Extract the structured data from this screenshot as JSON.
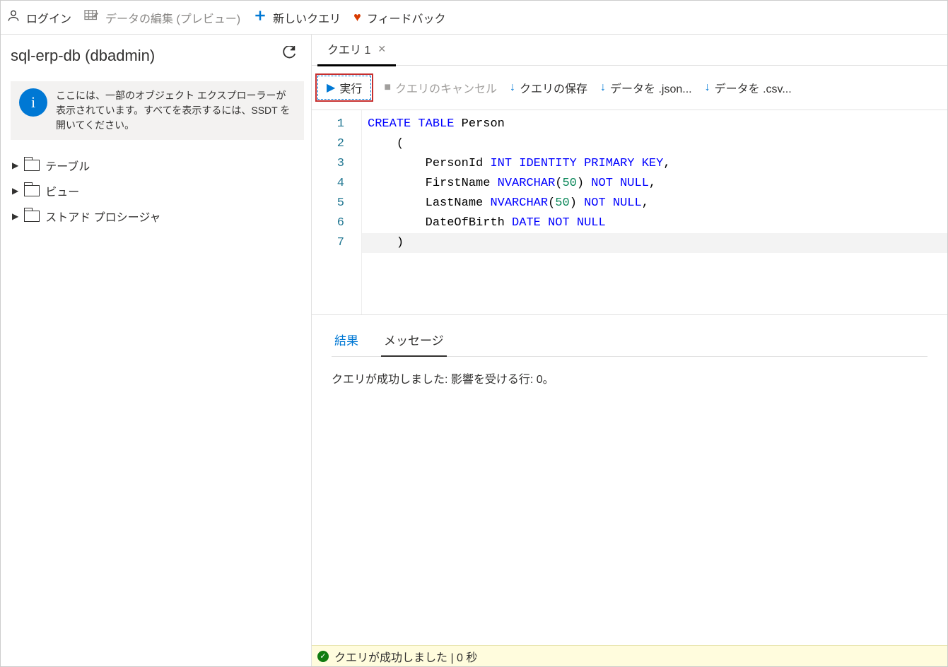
{
  "toolbar": {
    "login": "ログイン",
    "edit_data": "データの編集 (プレビュー)",
    "new_query": "新しいクエリ",
    "feedback": "フィードバック"
  },
  "sidebar": {
    "db_title": "sql-erp-db (dbadmin)",
    "info_text": "ここには、一部のオブジェクト エクスプローラーが表示されています。すべてを表示するには、SSDT を開いてください。",
    "tree": [
      {
        "label": "テーブル"
      },
      {
        "label": "ビュー"
      },
      {
        "label": "ストアド プロシージャ"
      }
    ]
  },
  "tabs": {
    "query_tab": "クエリ 1"
  },
  "actions": {
    "run": "実行",
    "cancel": "クエリのキャンセル",
    "save": "クエリの保存",
    "export_json": "データを .json...",
    "export_csv": "データを .csv..."
  },
  "editor": {
    "lines": [
      {
        "n": 1,
        "tokens": [
          [
            "kw",
            "CREATE"
          ],
          [
            "sp",
            " "
          ],
          [
            "kw",
            "TABLE"
          ],
          [
            "sp",
            " "
          ],
          [
            "ident",
            "Person"
          ]
        ]
      },
      {
        "n": 2,
        "tokens": [
          [
            "sp",
            "    "
          ],
          [
            "ident",
            "("
          ]
        ]
      },
      {
        "n": 3,
        "tokens": [
          [
            "sp",
            "        "
          ],
          [
            "ident",
            "PersonId "
          ],
          [
            "kw",
            "INT"
          ],
          [
            "sp",
            " "
          ],
          [
            "kw",
            "IDENTITY"
          ],
          [
            "sp",
            " "
          ],
          [
            "kw",
            "PRIMARY"
          ],
          [
            "sp",
            " "
          ],
          [
            "kw",
            "KEY"
          ],
          [
            "ident",
            ","
          ]
        ]
      },
      {
        "n": 4,
        "tokens": [
          [
            "sp",
            "        "
          ],
          [
            "ident",
            "FirstName "
          ],
          [
            "kw",
            "NVARCHAR"
          ],
          [
            "ident",
            "("
          ],
          [
            "num",
            "50"
          ],
          [
            "ident",
            ") "
          ],
          [
            "kw",
            "NOT"
          ],
          [
            "sp",
            " "
          ],
          [
            "kw",
            "NULL"
          ],
          [
            "ident",
            ","
          ]
        ]
      },
      {
        "n": 5,
        "tokens": [
          [
            "sp",
            "        "
          ],
          [
            "ident",
            "LastName "
          ],
          [
            "kw",
            "NVARCHAR"
          ],
          [
            "ident",
            "("
          ],
          [
            "num",
            "50"
          ],
          [
            "ident",
            ") "
          ],
          [
            "kw",
            "NOT"
          ],
          [
            "sp",
            " "
          ],
          [
            "kw",
            "NULL"
          ],
          [
            "ident",
            ","
          ]
        ]
      },
      {
        "n": 6,
        "tokens": [
          [
            "sp",
            "        "
          ],
          [
            "ident",
            "DateOfBirth "
          ],
          [
            "kw",
            "DATE"
          ],
          [
            "sp",
            " "
          ],
          [
            "kw",
            "NOT"
          ],
          [
            "sp",
            " "
          ],
          [
            "kw",
            "NULL"
          ]
        ]
      },
      {
        "n": 7,
        "active": true,
        "tokens": [
          [
            "sp",
            "    "
          ],
          [
            "ident",
            ")"
          ]
        ]
      }
    ]
  },
  "results": {
    "tab_results": "結果",
    "tab_messages": "メッセージ",
    "message": "クエリが成功しました: 影響を受ける行: 0。"
  },
  "status": {
    "text": "クエリが成功しました | 0 秒"
  }
}
